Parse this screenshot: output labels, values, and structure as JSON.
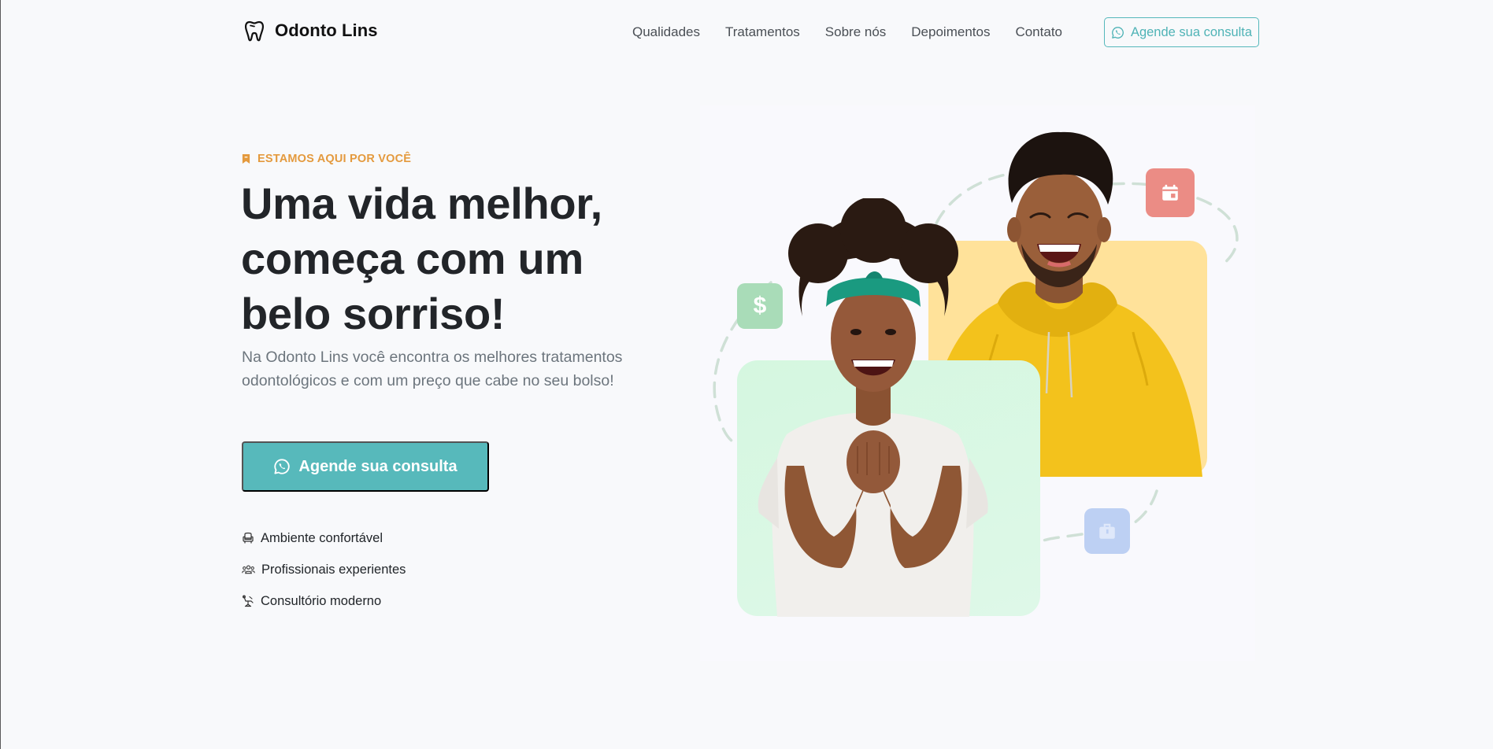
{
  "brand": {
    "name": "Odonto Lins",
    "icon": "tooth-icon"
  },
  "nav": {
    "links": [
      "Qualidades",
      "Tratamentos",
      "Sobre nós",
      "Depoimentos",
      "Contato"
    ],
    "cta": "Agende sua consulta"
  },
  "hero": {
    "eyebrow": "ESTAMOS AQUI POR VOCÊ",
    "title_lines": [
      "Uma vida melhor,",
      "começa com um",
      "belo sorriso!"
    ],
    "description": "Na Odonto Lins você encontra os melhores tratamentos odontológicos e com um preço que cabe no seu bolso!",
    "button": "Agende sua consulta",
    "features": [
      {
        "icon": "armchair-icon",
        "label": "Ambiente confortável"
      },
      {
        "icon": "people-icon",
        "label": "Profissionais experientes"
      },
      {
        "icon": "dental-chair-icon",
        "label": "Consultório moderno"
      }
    ]
  },
  "illustration": {
    "badges": [
      "dollar-icon",
      "calendar-icon",
      "briefcase-icon"
    ],
    "dollar_symbol": "$"
  },
  "colors": {
    "accent": "#57b9bb",
    "eyebrow": "#e49a3e",
    "green_card": "#d5f7e0",
    "yellow_card": "#ffe29a",
    "badge_dollar": "#a9dcb8",
    "badge_calendar": "#eb8c85",
    "badge_bag": "#bdd0f3"
  }
}
